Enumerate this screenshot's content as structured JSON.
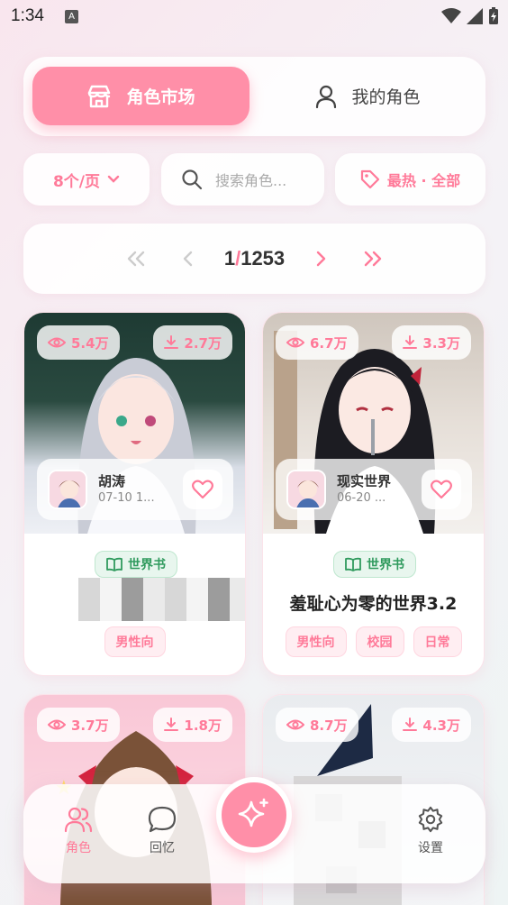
{
  "status_bar": {
    "time": "1:34",
    "indicator": "A"
  },
  "tabs": {
    "market_label": "角色市场",
    "mine_label": "我的角色"
  },
  "filters": {
    "per_page": "8个/页",
    "search_placeholder": "搜索角色...",
    "sort": "最热 · 全部"
  },
  "pagination": {
    "current": "1",
    "separator": "/",
    "total": "1253"
  },
  "cards": [
    {
      "views": "5.4万",
      "downloads": "2.7万",
      "author": "胡涛",
      "date": "07-10 1...",
      "badge": "世界书",
      "title": "",
      "tags": [
        "男性向"
      ]
    },
    {
      "views": "6.7万",
      "downloads": "3.3万",
      "author": "现实世界",
      "date": "06-20 ...",
      "badge": "世界书",
      "title": "羞耻心为零的世界3.2",
      "tags": [
        "男性向",
        "校园",
        "日常"
      ]
    },
    {
      "views": "3.7万",
      "downloads": "1.8万"
    },
    {
      "views": "8.7万",
      "downloads": "4.3万"
    }
  ],
  "bottom_nav": {
    "roles_label": "角色",
    "memory_label": "回忆",
    "settings_label": "设置"
  },
  "colors": {
    "accent": "#ff8fa8",
    "accent_text": "#ff7a99",
    "badge_green": "#2f9a5d"
  }
}
